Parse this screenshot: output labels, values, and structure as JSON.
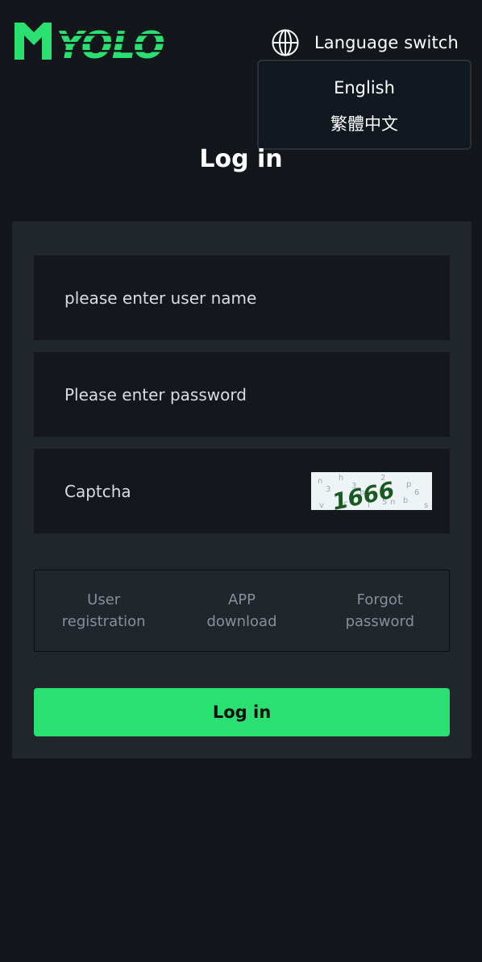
{
  "header": {
    "logo_text": "YOLO",
    "language_switch_label": "Language switch"
  },
  "language_menu": {
    "options": [
      "English",
      "繁體中文"
    ]
  },
  "page_title": "Log in",
  "form": {
    "username_placeholder": "please enter user name",
    "password_placeholder": "Please enter password",
    "captcha_placeholder": "Captcha",
    "captcha_code": "1666"
  },
  "links": {
    "register": [
      "User",
      "registration"
    ],
    "app": [
      "APP",
      "download"
    ],
    "forgot": [
      "Forgot",
      "password"
    ]
  },
  "login_button": "Log in",
  "colors": {
    "brand_green": "#2ae071",
    "background": "#13171b",
    "card": "#21262c",
    "field": "#14181c"
  }
}
